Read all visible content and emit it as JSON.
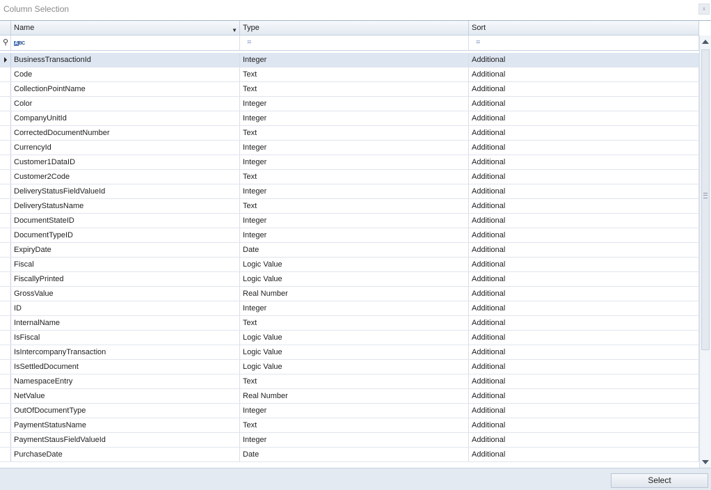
{
  "window": {
    "title": "Column Selection",
    "close_label": "x"
  },
  "grid": {
    "columns": {
      "name": "Name",
      "type": "Type",
      "sort": "Sort"
    },
    "filter": {
      "name_icon": "abc-filter-icon",
      "type_icon": "equals-icon",
      "sort_icon": "equals-icon"
    },
    "rows": [
      {
        "name": "BusinessTransactionId",
        "type": "Integer",
        "sort": "Additional"
      },
      {
        "name": "Code",
        "type": "Text",
        "sort": "Additional"
      },
      {
        "name": "CollectionPointName",
        "type": "Text",
        "sort": "Additional"
      },
      {
        "name": "Color",
        "type": "Integer",
        "sort": "Additional"
      },
      {
        "name": "CompanyUnitId",
        "type": "Integer",
        "sort": "Additional"
      },
      {
        "name": "CorrectedDocumentNumber",
        "type": "Text",
        "sort": "Additional"
      },
      {
        "name": "CurrencyId",
        "type": "Integer",
        "sort": "Additional"
      },
      {
        "name": "Customer1DataID",
        "type": "Integer",
        "sort": "Additional"
      },
      {
        "name": "Customer2Code",
        "type": "Text",
        "sort": "Additional"
      },
      {
        "name": "DeliveryStatusFieldValueId",
        "type": "Integer",
        "sort": "Additional"
      },
      {
        "name": "DeliveryStatusName",
        "type": "Text",
        "sort": "Additional"
      },
      {
        "name": "DocumentStateID",
        "type": "Integer",
        "sort": "Additional"
      },
      {
        "name": "DocumentTypeID",
        "type": "Integer",
        "sort": "Additional"
      },
      {
        "name": "ExpiryDate",
        "type": "Date",
        "sort": "Additional"
      },
      {
        "name": "Fiscal",
        "type": "Logic Value",
        "sort": "Additional"
      },
      {
        "name": "FiscallyPrinted",
        "type": "Logic Value",
        "sort": "Additional"
      },
      {
        "name": "GrossValue",
        "type": "Real Number",
        "sort": "Additional"
      },
      {
        "name": "ID",
        "type": "Integer",
        "sort": "Additional"
      },
      {
        "name": "InternalName",
        "type": "Text",
        "sort": "Additional"
      },
      {
        "name": "IsFiscal",
        "type": "Logic Value",
        "sort": "Additional"
      },
      {
        "name": "IsIntercompanyTransaction",
        "type": "Logic Value",
        "sort": "Additional"
      },
      {
        "name": "IsSettledDocument",
        "type": "Logic Value",
        "sort": "Additional"
      },
      {
        "name": "NamespaceEntry",
        "type": "Text",
        "sort": "Additional"
      },
      {
        "name": "NetValue",
        "type": "Real Number",
        "sort": "Additional"
      },
      {
        "name": "OutOfDocumentType",
        "type": "Integer",
        "sort": "Additional"
      },
      {
        "name": "PaymentStatusName",
        "type": "Text",
        "sort": "Additional"
      },
      {
        "name": "PaymentStausFieldValueId",
        "type": "Integer",
        "sort": "Additional"
      },
      {
        "name": "PurchaseDate",
        "type": "Date",
        "sort": "Additional"
      }
    ],
    "selected_row": 0
  },
  "footer": {
    "select_label": "Select"
  }
}
